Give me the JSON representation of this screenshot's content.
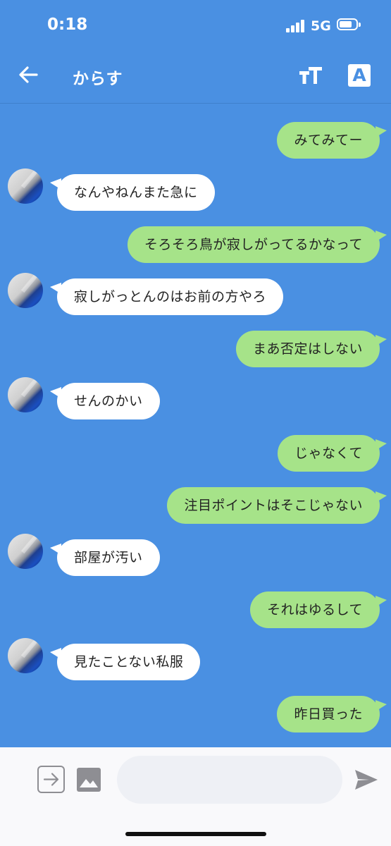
{
  "status": {
    "time": "0:18",
    "network": "5G"
  },
  "header": {
    "title": "からす",
    "translate_label": "A"
  },
  "messages": [
    {
      "side": "out",
      "text": "みてみてー"
    },
    {
      "side": "in",
      "text": "なんやねんまた急に"
    },
    {
      "side": "out",
      "text": "そろそろ鳥が寂しがってるかなって"
    },
    {
      "side": "in",
      "text": "寂しがっとんのはお前の方やろ"
    },
    {
      "side": "out",
      "text": "まあ否定はしない"
    },
    {
      "side": "in",
      "text": "せんのかい"
    },
    {
      "side": "out",
      "text": "じゃなくて"
    },
    {
      "side": "out",
      "text": "注目ポイントはそこじゃない"
    },
    {
      "side": "in",
      "text": "部屋が汚い"
    },
    {
      "side": "out",
      "text": "それはゆるして"
    },
    {
      "side": "in",
      "text": "見たことない私服"
    },
    {
      "side": "out",
      "text": "昨日買った"
    }
  ],
  "input": {
    "value": "",
    "placeholder": ""
  },
  "icons": {
    "back": "arrow-left-icon",
    "font_size": "font-size-icon",
    "translate": "translate-icon",
    "attach": "arrow-right-box-icon",
    "image": "image-icon",
    "send": "send-icon"
  },
  "colors": {
    "background": "#4a90e2",
    "outgoing": "#a6e389",
    "incoming": "#ffffff"
  }
}
